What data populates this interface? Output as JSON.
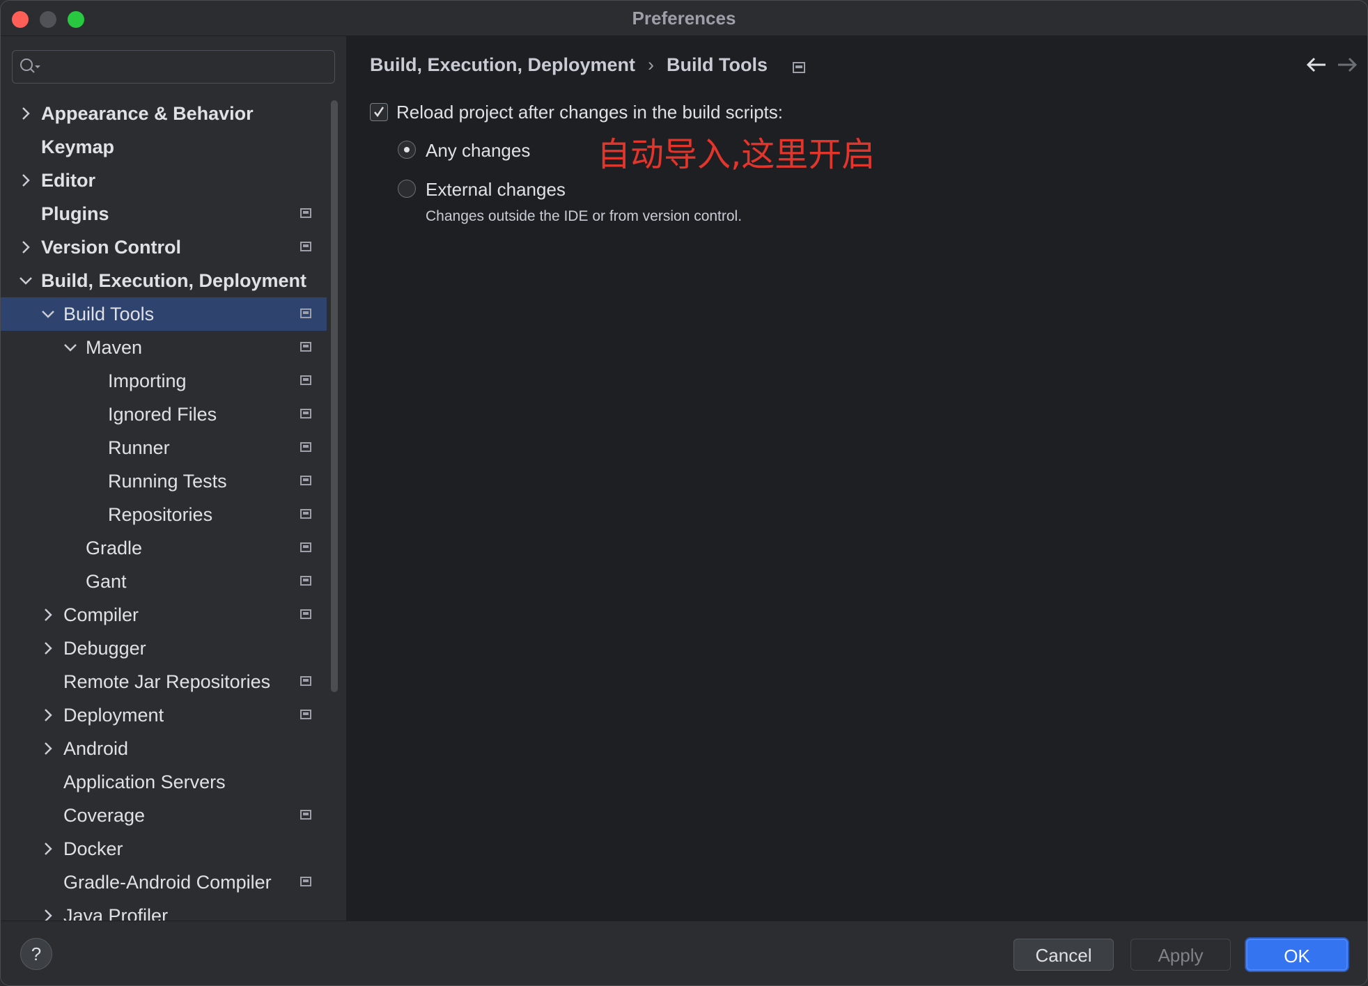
{
  "window": {
    "title": "Preferences"
  },
  "sidebar": {
    "search": {
      "placeholder": "",
      "icon": "search-icon"
    },
    "items": [
      {
        "label": "Appearance & Behavior",
        "level": 0,
        "expandable": true,
        "expanded": false,
        "bold": true,
        "project_icon": false
      },
      {
        "label": "Keymap",
        "level": 0,
        "expandable": false,
        "bold": true,
        "project_icon": false
      },
      {
        "label": "Editor",
        "level": 0,
        "expandable": true,
        "expanded": false,
        "bold": true,
        "project_icon": false
      },
      {
        "label": "Plugins",
        "level": 0,
        "expandable": false,
        "bold": true,
        "project_icon": true
      },
      {
        "label": "Version Control",
        "level": 0,
        "expandable": true,
        "expanded": false,
        "bold": true,
        "project_icon": true
      },
      {
        "label": "Build, Execution, Deployment",
        "level": 0,
        "expandable": true,
        "expanded": true,
        "bold": true,
        "project_icon": false
      },
      {
        "label": "Build Tools",
        "level": 1,
        "expandable": true,
        "expanded": true,
        "selected": true,
        "project_icon": true
      },
      {
        "label": "Maven",
        "level": 2,
        "expandable": true,
        "expanded": true,
        "project_icon": true
      },
      {
        "label": "Importing",
        "level": 3,
        "expandable": false,
        "project_icon": true
      },
      {
        "label": "Ignored Files",
        "level": 3,
        "expandable": false,
        "project_icon": true
      },
      {
        "label": "Runner",
        "level": 3,
        "expandable": false,
        "project_icon": true
      },
      {
        "label": "Running Tests",
        "level": 3,
        "expandable": false,
        "project_icon": true
      },
      {
        "label": "Repositories",
        "level": 3,
        "expandable": false,
        "project_icon": true
      },
      {
        "label": "Gradle",
        "level": 2,
        "expandable": false,
        "project_icon": true
      },
      {
        "label": "Gant",
        "level": 2,
        "expandable": false,
        "project_icon": true
      },
      {
        "label": "Compiler",
        "level": 1,
        "expandable": true,
        "expanded": false,
        "project_icon": true
      },
      {
        "label": "Debugger",
        "level": 1,
        "expandable": true,
        "expanded": false,
        "project_icon": false
      },
      {
        "label": "Remote Jar Repositories",
        "level": 1,
        "expandable": false,
        "project_icon": true
      },
      {
        "label": "Deployment",
        "level": 1,
        "expandable": true,
        "expanded": false,
        "project_icon": true
      },
      {
        "label": "Android",
        "level": 1,
        "expandable": true,
        "expanded": false,
        "project_icon": false
      },
      {
        "label": "Application Servers",
        "level": 1,
        "expandable": false,
        "project_icon": false
      },
      {
        "label": "Coverage",
        "level": 1,
        "expandable": false,
        "project_icon": true
      },
      {
        "label": "Docker",
        "level": 1,
        "expandable": true,
        "expanded": false,
        "project_icon": false
      },
      {
        "label": "Gradle-Android Compiler",
        "level": 1,
        "expandable": false,
        "project_icon": true
      },
      {
        "label": "Java Profiler",
        "level": 1,
        "expandable": true,
        "expanded": false,
        "project_icon": false
      }
    ]
  },
  "content": {
    "breadcrumb": {
      "parent": "Build, Execution, Deployment",
      "separator": "›",
      "current": "Build Tools"
    },
    "reload_checkbox": {
      "label": "Reload project after changes in the build scripts:",
      "checked": true
    },
    "radio_any": {
      "label": "Any changes",
      "selected": true
    },
    "radio_external": {
      "label": "External changes",
      "selected": false
    },
    "external_hint": "Changes outside the IDE or from version control.",
    "annotation": "自动导入,这里开启"
  },
  "footer": {
    "help": "?",
    "cancel": "Cancel",
    "apply": "Apply",
    "ok": "OK"
  },
  "colors": {
    "accent": "#3574f0",
    "selection": "#2e436e",
    "annotation": "#e2362c"
  }
}
